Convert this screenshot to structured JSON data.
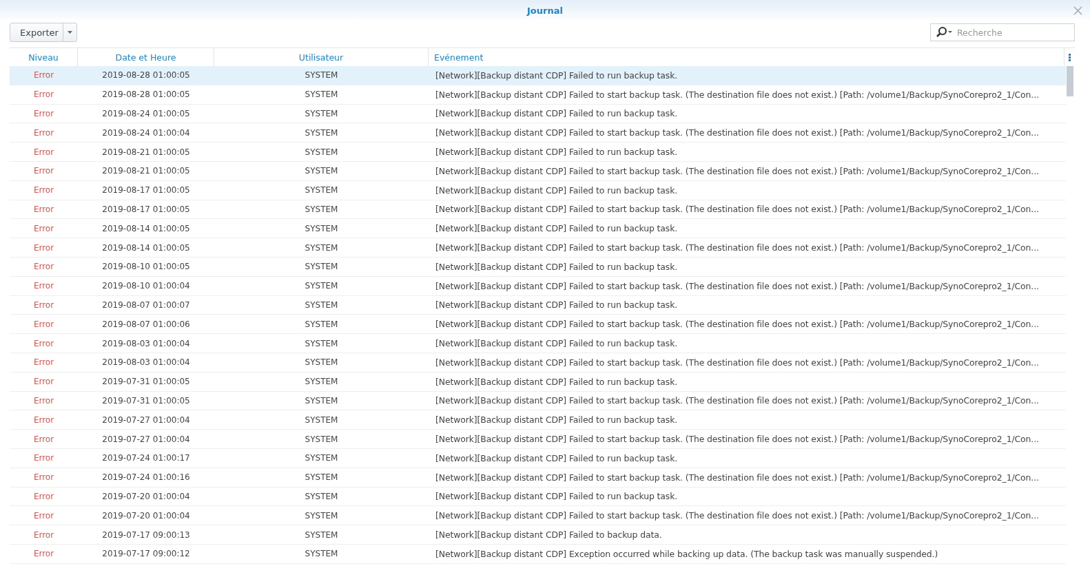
{
  "window": {
    "title": "Journal"
  },
  "toolbar": {
    "export_button": "Exporter",
    "search": {
      "placeholder": "Recherche"
    }
  },
  "table": {
    "columns": [
      "Niveau",
      "Date et Heure",
      "Utilisateur",
      "Evénement"
    ],
    "rows": [
      {
        "level": "Error",
        "kind": "error",
        "datetime": "2019-08-28 01:00:05",
        "user": "SYSTEM",
        "event": "[Network][Backup distant CDP] Failed to run backup task.",
        "selected": true
      },
      {
        "level": "Error",
        "kind": "error",
        "datetime": "2019-08-28 01:00:05",
        "user": "SYSTEM",
        "event": "[Network][Backup distant CDP] Failed to start backup task. (The destination file does not exist.) [Path: /volume1/Backup/SynoCorepro2_1/Con...",
        "selected": false
      },
      {
        "level": "Error",
        "kind": "error",
        "datetime": "2019-08-24 01:00:05",
        "user": "SYSTEM",
        "event": "[Network][Backup distant CDP] Failed to run backup task.",
        "selected": false
      },
      {
        "level": "Error",
        "kind": "error",
        "datetime": "2019-08-24 01:00:04",
        "user": "SYSTEM",
        "event": "[Network][Backup distant CDP] Failed to start backup task. (The destination file does not exist.) [Path: /volume1/Backup/SynoCorepro2_1/Con...",
        "selected": false
      },
      {
        "level": "Error",
        "kind": "error",
        "datetime": "2019-08-21 01:00:05",
        "user": "SYSTEM",
        "event": "[Network][Backup distant CDP] Failed to run backup task.",
        "selected": false
      },
      {
        "level": "Error",
        "kind": "error",
        "datetime": "2019-08-21 01:00:05",
        "user": "SYSTEM",
        "event": "[Network][Backup distant CDP] Failed to start backup task. (The destination file does not exist.) [Path: /volume1/Backup/SynoCorepro2_1/Con...",
        "selected": false
      },
      {
        "level": "Error",
        "kind": "error",
        "datetime": "2019-08-17 01:00:05",
        "user": "SYSTEM",
        "event": "[Network][Backup distant CDP] Failed to run backup task.",
        "selected": false
      },
      {
        "level": "Error",
        "kind": "error",
        "datetime": "2019-08-17 01:00:05",
        "user": "SYSTEM",
        "event": "[Network][Backup distant CDP] Failed to start backup task. (The destination file does not exist.) [Path: /volume1/Backup/SynoCorepro2_1/Con...",
        "selected": false
      },
      {
        "level": "Error",
        "kind": "error",
        "datetime": "2019-08-14 01:00:05",
        "user": "SYSTEM",
        "event": "[Network][Backup distant CDP] Failed to run backup task.",
        "selected": false
      },
      {
        "level": "Error",
        "kind": "error",
        "datetime": "2019-08-14 01:00:05",
        "user": "SYSTEM",
        "event": "[Network][Backup distant CDP] Failed to start backup task. (The destination file does not exist.) [Path: /volume1/Backup/SynoCorepro2_1/Con...",
        "selected": false
      },
      {
        "level": "Error",
        "kind": "error",
        "datetime": "2019-08-10 01:00:05",
        "user": "SYSTEM",
        "event": "[Network][Backup distant CDP] Failed to run backup task.",
        "selected": false
      },
      {
        "level": "Error",
        "kind": "error",
        "datetime": "2019-08-10 01:00:04",
        "user": "SYSTEM",
        "event": "[Network][Backup distant CDP] Failed to start backup task. (The destination file does not exist.) [Path: /volume1/Backup/SynoCorepro2_1/Con...",
        "selected": false
      },
      {
        "level": "Error",
        "kind": "error",
        "datetime": "2019-08-07 01:00:07",
        "user": "SYSTEM",
        "event": "[Network][Backup distant CDP] Failed to run backup task.",
        "selected": false
      },
      {
        "level": "Error",
        "kind": "error",
        "datetime": "2019-08-07 01:00:06",
        "user": "SYSTEM",
        "event": "[Network][Backup distant CDP] Failed to start backup task. (The destination file does not exist.) [Path: /volume1/Backup/SynoCorepro2_1/Con...",
        "selected": false
      },
      {
        "level": "Error",
        "kind": "error",
        "datetime": "2019-08-03 01:00:04",
        "user": "SYSTEM",
        "event": "[Network][Backup distant CDP] Failed to run backup task.",
        "selected": false
      },
      {
        "level": "Error",
        "kind": "error",
        "datetime": "2019-08-03 01:00:04",
        "user": "SYSTEM",
        "event": "[Network][Backup distant CDP] Failed to start backup task. (The destination file does not exist.) [Path: /volume1/Backup/SynoCorepro2_1/Con...",
        "selected": false
      },
      {
        "level": "Error",
        "kind": "error",
        "datetime": "2019-07-31 01:00:05",
        "user": "SYSTEM",
        "event": "[Network][Backup distant CDP] Failed to run backup task.",
        "selected": false
      },
      {
        "level": "Error",
        "kind": "error",
        "datetime": "2019-07-31 01:00:05",
        "user": "SYSTEM",
        "event": "[Network][Backup distant CDP] Failed to start backup task. (The destination file does not exist.) [Path: /volume1/Backup/SynoCorepro2_1/Con...",
        "selected": false
      },
      {
        "level": "Error",
        "kind": "error",
        "datetime": "2019-07-27 01:00:04",
        "user": "SYSTEM",
        "event": "[Network][Backup distant CDP] Failed to run backup task.",
        "selected": false
      },
      {
        "level": "Error",
        "kind": "error",
        "datetime": "2019-07-27 01:00:04",
        "user": "SYSTEM",
        "event": "[Network][Backup distant CDP] Failed to start backup task. (The destination file does not exist.) [Path: /volume1/Backup/SynoCorepro2_1/Con...",
        "selected": false
      },
      {
        "level": "Error",
        "kind": "error",
        "datetime": "2019-07-24 01:00:17",
        "user": "SYSTEM",
        "event": "[Network][Backup distant CDP] Failed to run backup task.",
        "selected": false
      },
      {
        "level": "Error",
        "kind": "error",
        "datetime": "2019-07-24 01:00:16",
        "user": "SYSTEM",
        "event": "[Network][Backup distant CDP] Failed to start backup task. (The destination file does not exist.) [Path: /volume1/Backup/SynoCorepro2_1/Con...",
        "selected": false
      },
      {
        "level": "Error",
        "kind": "error",
        "datetime": "2019-07-20 01:00:04",
        "user": "SYSTEM",
        "event": "[Network][Backup distant CDP] Failed to run backup task.",
        "selected": false
      },
      {
        "level": "Error",
        "kind": "error",
        "datetime": "2019-07-20 01:00:04",
        "user": "SYSTEM",
        "event": "[Network][Backup distant CDP] Failed to start backup task. (The destination file does not exist.) [Path: /volume1/Backup/SynoCorepro2_1/Con...",
        "selected": false
      },
      {
        "level": "Error",
        "kind": "error",
        "datetime": "2019-07-17 09:00:13",
        "user": "SYSTEM",
        "event": "[Network][Backup distant CDP] Failed to backup data.",
        "selected": false
      },
      {
        "level": "Error",
        "kind": "error",
        "datetime": "2019-07-17 09:00:12",
        "user": "SYSTEM",
        "event": "[Network][Backup distant CDP] Exception occurred while backing up data. (The backup task was manually suspended.)",
        "selected": false
      }
    ]
  }
}
